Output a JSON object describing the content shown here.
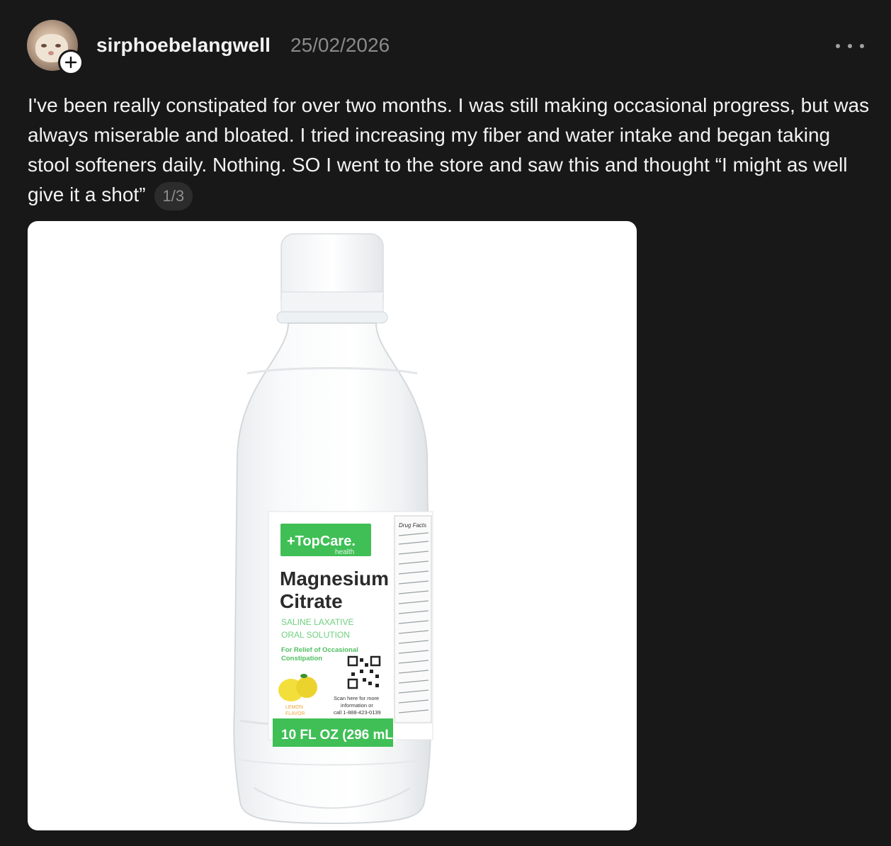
{
  "post": {
    "username": "sirphoebelangwell",
    "date": "25/02/2026",
    "text": "I've been really constipated for over two months. I was still making occasional progress, but was always miserable and bloated. I tried increasing my fiber and water intake and began taking stool softeners daily. Nothing. SO I went to the store and saw this and thought “I might as well give it a shot”",
    "page_indicator": "1/3"
  },
  "icons": {
    "avatar": "cat-avatar",
    "follow": "plus-icon",
    "more": "more-dots-icon"
  },
  "product_label": {
    "brand": "+TopCare.",
    "brand_sub": "health",
    "product_line1": "Magnesium",
    "product_line2": "Citrate",
    "type_line1": "SALINE LAXATIVE",
    "type_line2": "ORAL SOLUTION",
    "use_line1": "For Relief of Occasional",
    "use_line2": "Constipation",
    "flavor_line1": "LEMON",
    "flavor_line2": "FLAVOR",
    "scan_line1": "Scan here for more",
    "scan_line2": "information or",
    "scan_line3": "call 1-888-423-0139",
    "volume": "10 FL OZ (296 mL)",
    "side_title": "Drug Facts"
  },
  "colors": {
    "background": "#181818",
    "brand_green": "#3fbf55",
    "muted_text": "#8a8a8a"
  }
}
